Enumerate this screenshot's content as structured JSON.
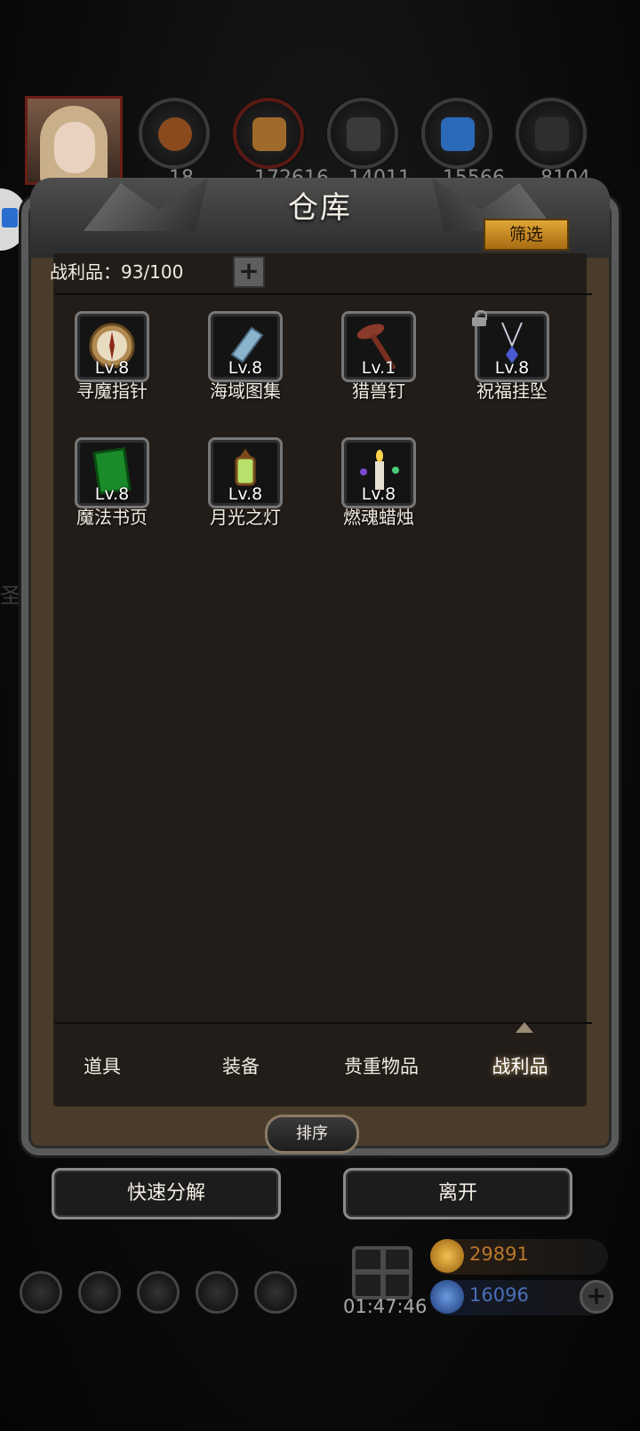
{
  "window": {
    "title": "仓库",
    "filter_label": "筛选"
  },
  "inventory": {
    "count_label": "战利品：93/100",
    "items": [
      {
        "name": "寻魔指针",
        "level": "Lv.8",
        "icon": "compass-icon",
        "locked": false
      },
      {
        "name": "海域图集",
        "level": "Lv.8",
        "icon": "book-icon",
        "locked": false
      },
      {
        "name": "猎兽钉",
        "level": "Lv.1",
        "icon": "spike-icon",
        "locked": false
      },
      {
        "name": "祝福挂坠",
        "level": "Lv.8",
        "icon": "pendant-icon",
        "locked": true
      },
      {
        "name": "魔法书页",
        "level": "Lv.8",
        "icon": "spellbook-page-icon",
        "locked": false
      },
      {
        "name": "月光之灯",
        "level": "Lv.8",
        "icon": "lantern-icon",
        "locked": false
      },
      {
        "name": "燃魂蜡烛",
        "level": "Lv.8",
        "icon": "candle-icon",
        "locked": false
      }
    ]
  },
  "tabs": [
    {
      "label": "道具",
      "active": false
    },
    {
      "label": "装备",
      "active": false
    },
    {
      "label": "贵重物品",
      "active": false
    },
    {
      "label": "战利品",
      "active": true
    }
  ],
  "buttons": {
    "sort": "排序",
    "quick_dismantle": "快速分解",
    "leave": "离开"
  },
  "resources": [
    "18",
    "172616",
    "14011",
    "15566",
    "8104"
  ],
  "hud": {
    "timer": "01:47:46",
    "gold": "29891",
    "gems": "16096"
  },
  "colors": {
    "accent_gold": "#e0a635",
    "frame": "#5a5a5a",
    "panel": "#221d19",
    "gold_text": "#b9782a",
    "gem_text": "#4a6fb8"
  }
}
